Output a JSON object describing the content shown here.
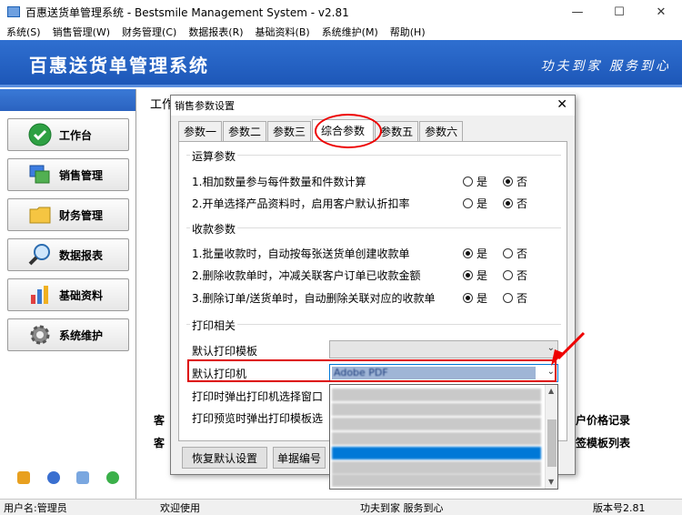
{
  "window": {
    "title": "百惠送货单管理系统 - Bestsmile Management System - v2.81"
  },
  "menu": [
    "系统(S)",
    "销售管理(W)",
    "财务管理(C)",
    "数据报表(R)",
    "基础资料(B)",
    "系统维护(M)",
    "帮助(H)"
  ],
  "banner": {
    "title": "百惠送货单管理系统",
    "slogan": "功夫到家 服务到心"
  },
  "sidebar": {
    "items": [
      "工作台",
      "销售管理",
      "财务管理",
      "数据报表",
      "基础资料",
      "系统维护"
    ]
  },
  "workarea": {
    "tab": "工作",
    "link1": "户价格记录",
    "link2": "签模板列表",
    "frag1": "客",
    "frag2": "客"
  },
  "status": {
    "user": "用户名:管理员",
    "welcome": "欢迎使用",
    "slogan": "功夫到家 服务到心",
    "version": "版本号2.81"
  },
  "dialog": {
    "title": "销售参数设置",
    "tabs": [
      "参数一",
      "参数二",
      "参数三",
      "综合参数",
      "参数五",
      "参数六"
    ],
    "active_tab": 3,
    "groups": {
      "calc": {
        "title": "运算参数",
        "rows": [
          {
            "label": "1.相加数量参与每件数量和件数计算",
            "value": "否"
          },
          {
            "label": "2.开单选择产品资料时，启用客户默认折扣率",
            "value": "否"
          }
        ]
      },
      "payment": {
        "title": "收款参数",
        "rows": [
          {
            "label": "1.批量收款时，自动按每张送货单创建收款单",
            "value": "是"
          },
          {
            "label": "2.删除收款单时，冲减关联客户订单已收款金额",
            "value": "是"
          },
          {
            "label": "3.删除订单/送货单时，自动删除关联对应的收款单",
            "value": "是"
          }
        ]
      },
      "print": {
        "title": "打印相关",
        "default_template_label": "默认打印模板",
        "default_template_value": "",
        "default_printer_label": "默认打印机",
        "default_printer_value": "Adobe PDF",
        "popup_printer_label": "打印时弹出打印机选择窗口",
        "popup_preview_label": "打印预览时弹出打印模板选"
      }
    },
    "radio_yes": "是",
    "radio_no": "否",
    "buttons": {
      "restore": "恢复默认设置",
      "code": "单据编号"
    }
  },
  "colors": {
    "banner": "#2f6fd0",
    "selection": "#0078d7",
    "annotation": "#e00000"
  }
}
